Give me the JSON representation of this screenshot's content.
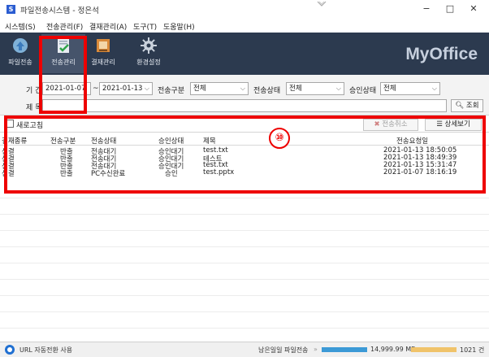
{
  "window": {
    "app_icon": "S",
    "title": "파일전송시스템 - 정은석",
    "minimize": "−",
    "maximize": "□",
    "close": "✕"
  },
  "menu": [
    "시스템(S)",
    "전송관리(F)",
    "결재관리(A)",
    "도구(T)",
    "도움말(H)"
  ],
  "toolbar": {
    "buttons": [
      "파일전송",
      "전송관리",
      "결재관리",
      "환경설정"
    ],
    "brand": "MyOffice"
  },
  "filters": {
    "period_label": "기 간",
    "date_from": "2021-01-07",
    "date_sep": "~",
    "date_to": "2021-01-13",
    "transfer_type_label": "전송구분",
    "transfer_type_value": "전체",
    "transfer_status_label": "전송상태",
    "transfer_status_value": "전체",
    "approval_status_label": "승인상태",
    "approval_status_value": "전체",
    "subject_label": "제 목",
    "subject_value": "",
    "search_button": "조회"
  },
  "actions": {
    "refresh_label": "새로고침",
    "cancel_transfer": "전송취소",
    "detail_view": "상세보기"
  },
  "table": {
    "columns": [
      "결재종류",
      "전송구분",
      "전송상태",
      "승인상태",
      "제목",
      "전송요청일"
    ],
    "rows": [
      [
        "선결",
        "반출",
        "전송대기",
        "승인대기",
        "test.txt",
        "2021-01-13 18:50:05"
      ],
      [
        "선결",
        "반출",
        "전송대기",
        "승인대기",
        "테스트",
        "2021-01-13 18:49:39"
      ],
      [
        "선결",
        "반출",
        "전송대기",
        "승인대기",
        "test.txt",
        "2021-01-13 15:31:47"
      ],
      [
        "선결",
        "반출",
        "PC수신완료",
        "승인",
        "test.pptx",
        "2021-01-07 18:16:19"
      ]
    ]
  },
  "status": {
    "url_text": "URL 자동전환 사용",
    "remaining_label": "남은일일 파일전송",
    "remaining_size": "14,999.99 MB",
    "remaining_count": "1021 건"
  },
  "annotation": {
    "number": "⑩",
    "color": "#ee0000"
  },
  "colors": {
    "toolbar_bg": "#2c3a4f",
    "accent_blue": "#1f6fd1",
    "annotation_red": "#ee0000"
  }
}
